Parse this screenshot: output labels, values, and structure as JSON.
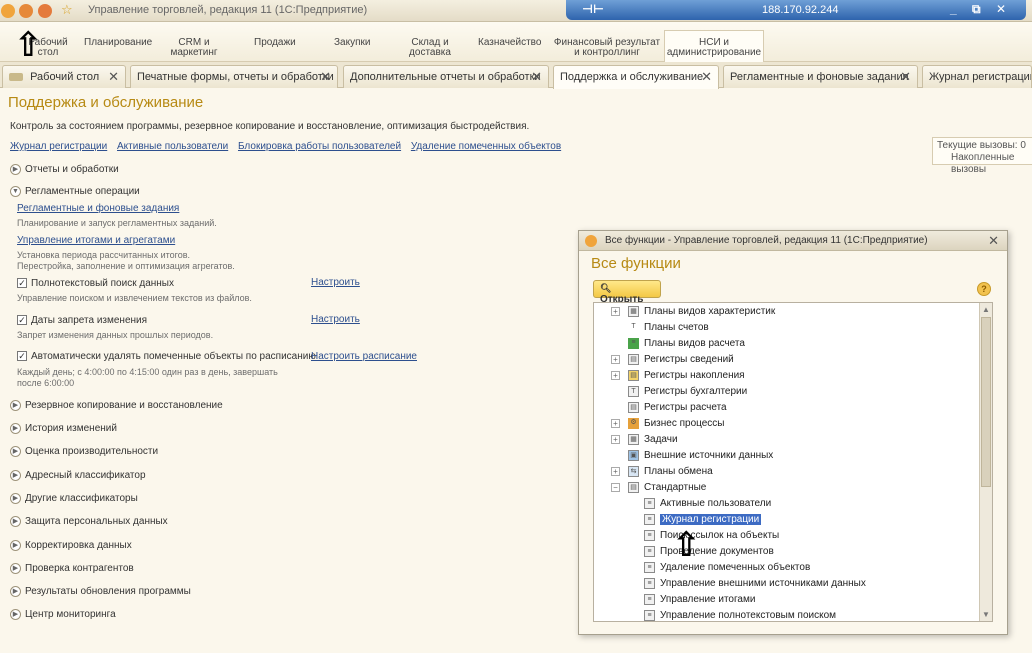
{
  "window": {
    "title": "Управление торговлей, редакция 11 (1С:Предприятие)",
    "remote_ip": "188.170.92.244"
  },
  "sections": [
    {
      "label": "Рабочий\nстол"
    },
    {
      "label": "Планирование"
    },
    {
      "label": "CRM и\nмаркетинг"
    },
    {
      "label": "Продажи"
    },
    {
      "label": "Закупки"
    },
    {
      "label": "Склад и\nдоставка"
    },
    {
      "label": "Казначейство"
    },
    {
      "label": "Финансовый результат\nи контроллинг"
    },
    {
      "label": "НСИ и\nадминистрирование"
    }
  ],
  "tabs": [
    {
      "label": "Рабочий стол"
    },
    {
      "label": "Печатные формы, отчеты и обработки"
    },
    {
      "label": "Дополнительные отчеты и обработки"
    },
    {
      "label": "Поддержка и обслуживание"
    },
    {
      "label": "Регламентные и фоновые задания"
    },
    {
      "label": "Журнал регистрации"
    }
  ],
  "page": {
    "title": "Поддержка и обслуживание",
    "description": "Контроль за состоянием программы, резервное копирование и восстановление, оптимизация быстродействия.",
    "top_links": [
      "Журнал регистрации",
      "Активные пользователи",
      "Блокировка работы пользователей",
      "Удаление помеченных объектов"
    ],
    "calls": {
      "current": "Текущие вызовы: 0",
      "accumulated": "Накопленные вызовы"
    },
    "groups": {
      "reports": "Отчеты и обработки",
      "routine": "Регламентные операции",
      "backup": "Резервное копирование и восстановление",
      "history": "История изменений",
      "perf": "Оценка производительности",
      "address": "Адресный классификатор",
      "other_cls": "Другие классификаторы",
      "pdp": "Защита персональных данных",
      "correction": "Корректировка данных",
      "counterparty": "Проверка контрагентов",
      "update_results": "Результаты обновления программы",
      "monitoring": "Центр мониторинга"
    },
    "routine": {
      "jobs_link": "Регламентные и фоновые задания",
      "jobs_note": "Планирование и запуск регламентных заданий.",
      "totals_link": "Управление итогами и агрегатами",
      "totals_note1": "Установка периода рассчитанных итогов.",
      "totals_note2": "Перестройка, заполнение и оптимизация агрегатов.",
      "fulltext": "Полнотекстовый поиск данных",
      "fulltext_note": "Управление поиском и извлечением текстов из файлов.",
      "fulltext_set": "Настроить",
      "dates": "Даты запрета изменения",
      "dates_note": "Запрет изменения данных прошлых периодов.",
      "dates_set": "Настроить",
      "autodel": "Автоматически удалять помеченные объекты по расписанию",
      "autodel_set": "Настроить расписание",
      "autodel_note1": "Каждый день; с 4:00:00 по 4:15:00 один раз в день, завершать",
      "autodel_note2": "после 6:00:00"
    }
  },
  "dialog": {
    "window_title": "Все функции - Управление торговлей, редакция 11 (1С:Предприятие)",
    "title": "Все функции",
    "open_button": "Открыть",
    "tree": [
      "Планы видов характеристик",
      "Планы счетов",
      "Планы видов расчета",
      "Регистры сведений",
      "Регистры накопления",
      "Регистры бухгалтерии",
      "Регистры расчета",
      "Бизнес процессы",
      "Задачи",
      "Внешние источники данных",
      "Планы обмена",
      "Стандартные",
      "Активные пользователи",
      "Журнал регистрации",
      "Поиск ссылок на объекты",
      "Проведение документов",
      "Удаление помеченных объектов",
      "Управление внешними источниками данных",
      "Управление итогами",
      "Управление полнотекстовым поиском"
    ]
  }
}
